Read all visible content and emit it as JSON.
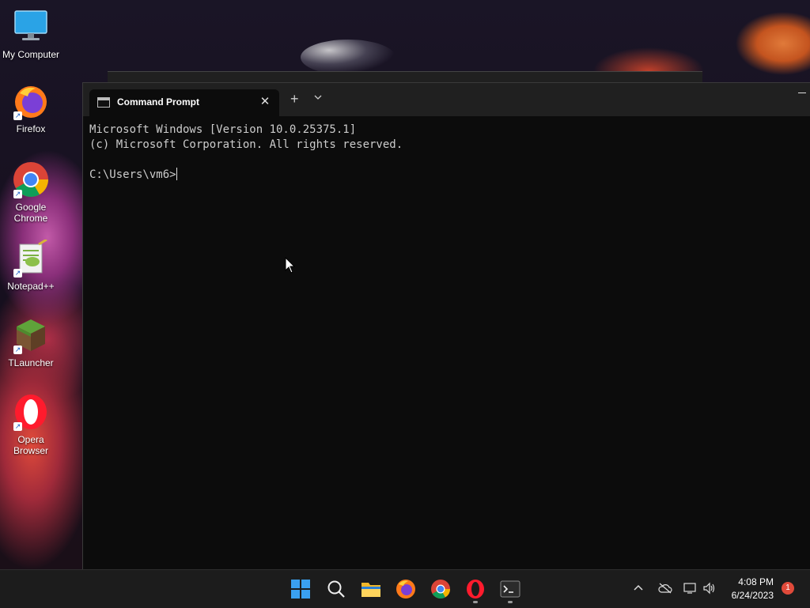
{
  "desktop": {
    "icons": [
      {
        "label": "My Computer"
      },
      {
        "label": "Firefox"
      },
      {
        "label": "Google Chrome"
      },
      {
        "label": "Notepad++"
      },
      {
        "label": "TLauncher"
      },
      {
        "label": "Opera Browser"
      }
    ],
    "shortcut_glyph": "↗"
  },
  "terminal": {
    "tab_title": "Command Prompt",
    "tab_close": "✕",
    "new_tab": "+",
    "dropdown": "⌄",
    "lines": [
      "Microsoft Windows [Version 10.0.25375.1]",
      "(c) Microsoft Corporation. All rights reserved.",
      "",
      "C:\\Users\\vm6>"
    ]
  },
  "taskbar": {
    "apps": [
      "start-icon",
      "search-icon",
      "file-explorer-icon",
      "firefox-icon",
      "chrome-icon",
      "opera-icon",
      "terminal-icon"
    ],
    "tray_chevron": "^",
    "time": "4:08 PM",
    "date": "6/24/2023",
    "notification_count": "1"
  },
  "colors": {
    "terminal_bg": "#0c0c0c",
    "tabbar_bg": "#202020",
    "taskbar_bg": "#1c1c1c",
    "text": "#cccccc"
  }
}
